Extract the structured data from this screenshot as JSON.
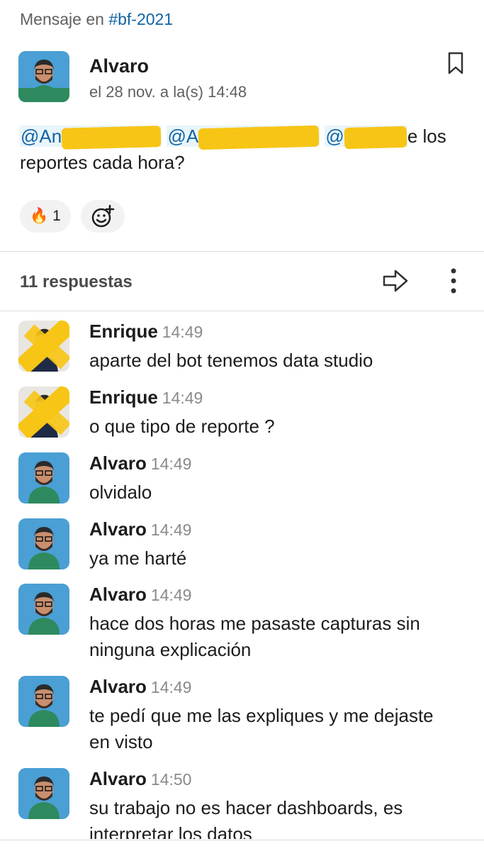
{
  "context": {
    "prefix": "Mensaje en",
    "channel": "#bf-2021"
  },
  "parent": {
    "author": "Alvaro",
    "date": "el 28 nov. a la(s) 14:48",
    "mentions": [
      "@An",
      "@A",
      "@"
    ],
    "text_tail": "e los",
    "text_line2": "reportes cada hora?",
    "reactions": [
      {
        "emoji": "🔥",
        "count": "1"
      }
    ]
  },
  "thread": {
    "replies_label": "11 respuestas"
  },
  "replies": [
    {
      "author": "Enrique",
      "time": "14:49",
      "text": "aparte del bot tenemos data studio"
    },
    {
      "author": "Enrique",
      "time": "14:49",
      "text": "o que tipo de reporte ?"
    },
    {
      "author": "Alvaro",
      "time": "14:49",
      "text": "olvidalo"
    },
    {
      "author": "Alvaro",
      "time": "14:49",
      "text": "ya me harté"
    },
    {
      "author": "Alvaro",
      "time": "14:49",
      "text": "hace dos horas me pasaste capturas sin ninguna explicación"
    },
    {
      "author": "Alvaro",
      "time": "14:49",
      "text": "te pedí que me las expliques y me dejaste en visto"
    },
    {
      "author": "Alvaro",
      "time": "14:50",
      "text": "su trabajo no es hacer dashboards, es interpretar los datos"
    }
  ],
  "colors": {
    "accent": "#1264a3",
    "redaction": "#f7c515",
    "avatar_bg": "#4a9fd4"
  }
}
